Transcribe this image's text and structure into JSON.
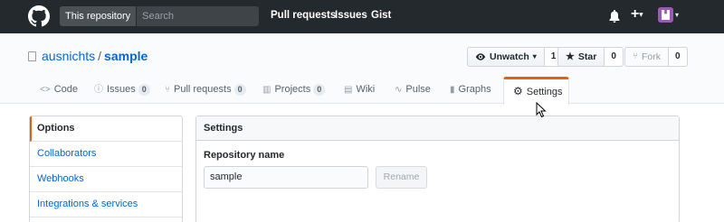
{
  "header": {
    "search_scope": "This repository",
    "search_placeholder": "Search",
    "nav": [
      "Pull requests",
      "Issues",
      "Gist"
    ],
    "plus_label": "+",
    "accent": "#24292e"
  },
  "repo": {
    "owner": "ausnichts",
    "separator": "/",
    "name": "sample",
    "watch_label": "Unwatch",
    "watch_caret": "▾",
    "watch_count": "1",
    "star_label": "Star",
    "star_count": "0",
    "fork_label": "Fork",
    "fork_count": "0"
  },
  "tabs": [
    {
      "label": "Code",
      "icon": "code-icon",
      "glyph": "<>"
    },
    {
      "label": "Issues",
      "icon": "issue-icon",
      "glyph": "ⓘ",
      "count": "0"
    },
    {
      "label": "Pull requests",
      "icon": "pull-request-icon",
      "glyph": "⑂",
      "count": "0"
    },
    {
      "label": "Projects",
      "icon": "project-icon",
      "glyph": "▥",
      "count": "0"
    },
    {
      "label": "Wiki",
      "icon": "wiki-icon",
      "glyph": "▤"
    },
    {
      "label": "Pulse",
      "icon": "pulse-icon",
      "glyph": "∿"
    },
    {
      "label": "Graphs",
      "icon": "graph-icon",
      "glyph": "▮"
    },
    {
      "label": "Settings",
      "icon": "gear-icon",
      "glyph": "⚙"
    }
  ],
  "sidebar": {
    "items": [
      {
        "label": "Options"
      },
      {
        "label": "Collaborators"
      },
      {
        "label": "Webhooks"
      },
      {
        "label": "Integrations & services"
      }
    ],
    "accent": "#e36209"
  },
  "settings": {
    "heading": "Settings",
    "repo_name_label": "Repository name",
    "repo_name_value": "sample",
    "rename_label": "Rename"
  }
}
